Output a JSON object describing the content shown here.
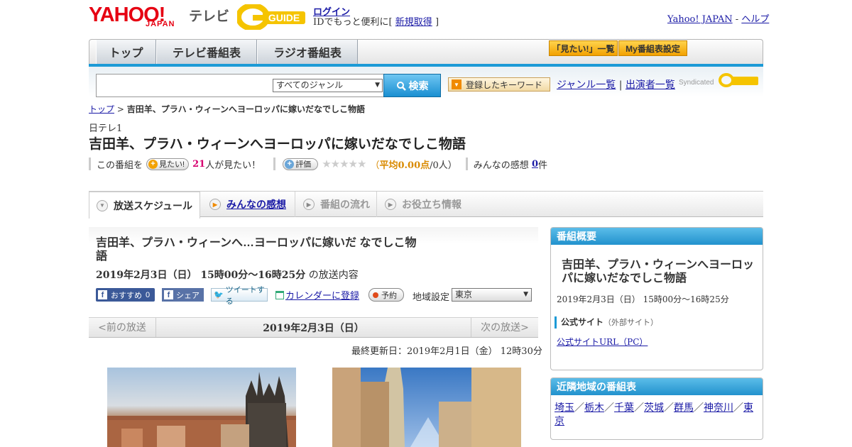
{
  "header": {
    "logo_yahoo": "YAHOO!",
    "logo_japan": "JAPAN",
    "logo_tv": "テレビ",
    "logo_gguide": "GUIDE",
    "login": "ログイン",
    "login_sub_prefix": "IDでもっと便利に[",
    "signup": "新規取得",
    "login_sub_suffix": "]",
    "yahoo_japan": "Yahoo! JAPAN",
    "separator": "-",
    "help": "ヘルプ"
  },
  "nav": {
    "tabs": [
      "トップ",
      "テレビ番組表",
      "ラジオ番組表"
    ],
    "wishlist_btn": "「見たい!」一覧",
    "my_schedule_btn": "My番組表設定"
  },
  "search": {
    "genre_selected": "すべてのジャンル",
    "button": "検索",
    "keyword_btn": "登録したキーワード",
    "genre_list": "ジャンル一覧",
    "sep": "|",
    "performer_list": "出演者一覧",
    "syndicated": "Syndicated"
  },
  "breadcrumb": {
    "top": "トップ",
    "sep": ">",
    "current": "吉田羊、プラハ・ウィーンへヨーロッパに嫁いだなでしこ物語"
  },
  "program": {
    "channel": "日テレ1",
    "title": "吉田羊、プラハ・ウィーンへヨーロッパに嫁いだなでしこ物語",
    "this_program": "この番組を",
    "want_btn": "見たい!",
    "want_count": "21",
    "want_suffix": "人が見たい！",
    "rate_btn": "評価",
    "stars": "★★★★★",
    "avg_open": "（",
    "avg_label": "平均0.00点",
    "avg_people": "/0人）",
    "reviews_label": "みんなの感想",
    "reviews_count": "0",
    "reviews_suffix": "件"
  },
  "tabs": {
    "schedule": "放送スケジュール",
    "reviews": "みんなの感想",
    "flow": "番組の流れ",
    "info": "お役立ち情報"
  },
  "main": {
    "title": "吉田羊、プラハ・ウィーンへ…ヨーロッパに嫁いだ なでしこ物語",
    "date_time": "2019年2月3日（日） 15時00分～16時25分",
    "broadcast_suffix": "の放送内容",
    "fb_recommend": "おすすめ",
    "fb_count": "0",
    "fb_share": "シェア",
    "tweet": "ツイートする",
    "calendar": "カレンダーに登録",
    "reserve": "予約",
    "region_label": "地域設定",
    "region_value": "東京",
    "prev": "<前の放送",
    "current_date": "2019年2月3日（日）",
    "next": "次の放送>",
    "updated": "最終更新日：2019年2月1日（金） 12時30分"
  },
  "sidebar": {
    "overview_title": "番組概要",
    "overview_program_title": "吉田羊、プラハ・ウィーンへヨーロッパに嫁いだなでしこ物語",
    "overview_time": "2019年2月3日（日） 15時00分～16時25分",
    "official_label": "公式サイト",
    "official_note": "（外部サイト）",
    "official_url": "公式サイトURL（PC）",
    "nearby_title": "近隣地域の番組表",
    "nearby_regions": [
      "埼玉",
      "栃木",
      "千葉",
      "茨城",
      "群馬",
      "神奈川",
      "東京"
    ],
    "nearby_sep": "／"
  },
  "colors": {
    "accent_blue": "#1c9ad6",
    "yahoo_red": "#e60012",
    "gguide_yellow": "#f5c400",
    "link": "#1a1aa6",
    "want_count": "#d6006f",
    "avg_orange": "#d98a00"
  }
}
